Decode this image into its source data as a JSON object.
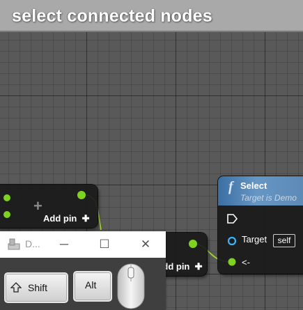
{
  "header": {
    "title": "select connected nodes"
  },
  "node_a": {
    "add_pin_label": "Add pin",
    "add_pin_icon": "plus-icon"
  },
  "node_b": {
    "add_pin_label": "Add pin"
  },
  "select_node": {
    "title": "Select",
    "subtitle": "Target is Demo",
    "target_label": "Target",
    "target_value": "self",
    "return_label": "<-"
  },
  "dialog": {
    "title": "D...",
    "minimize": "─",
    "maximize": "☐",
    "close": "✕",
    "keys": {
      "shift": "Shift",
      "alt": "Alt"
    }
  },
  "colors": {
    "exec_pin": "#ffffff",
    "data_pin": "#7ed321",
    "wire": "#a2d62b",
    "target_pin": "#3ab4ff"
  }
}
